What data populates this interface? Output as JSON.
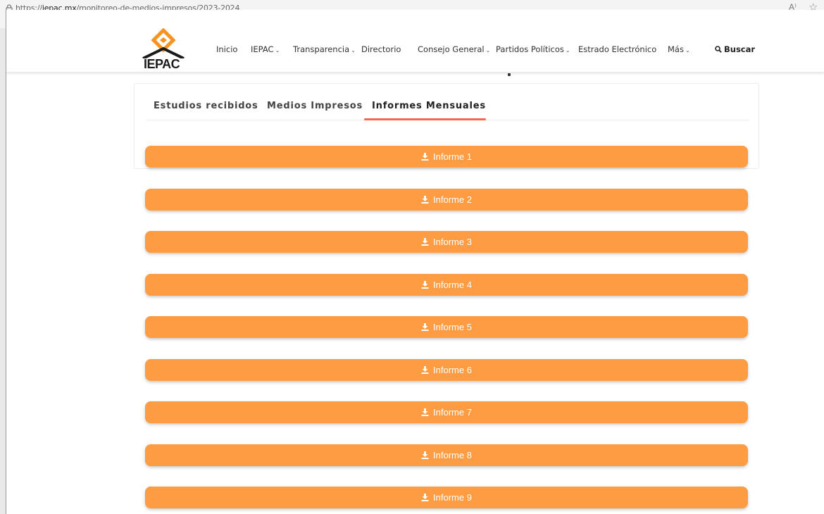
{
  "browser": {
    "url_prefix": "https://",
    "url_domain": "iepac.mx",
    "url_path": "/monitoreo-de-medios-impresos/2023-2024",
    "read_aloud_icon": "A⁾",
    "favorite_icon": "☆"
  },
  "header": {
    "logo_text": "IEPAC",
    "brand_color": "#f7931e",
    "nav": [
      {
        "label": "Inicio",
        "dropdown": false
      },
      {
        "label": "IEPAC",
        "dropdown": true
      },
      {
        "label": "Transparencia",
        "dropdown": true
      },
      {
        "label": "Directorio",
        "dropdown": false
      },
      {
        "label": "Consejo General",
        "dropdown": true
      },
      {
        "label": "Partidos Políticos",
        "dropdown": true
      },
      {
        "label": "Estrado Electrónico",
        "dropdown": false
      },
      {
        "label": "Más",
        "dropdown": true
      }
    ],
    "chevron": "⌄",
    "search_icon": "⌕",
    "search_label": "Buscar"
  },
  "tabs": {
    "items": [
      "Estudios recibidos",
      "Medios Impresos",
      "Informes Mensuales"
    ],
    "active_index": 2,
    "accent_color": "#ef6b4e"
  },
  "reports": {
    "button_color": "#fd9c42",
    "icon": "download-icon",
    "items": [
      "Informe 1",
      "Informe 2",
      "Informe 3",
      "Informe 4",
      "Informe 5",
      "Informe 6",
      "Informe 7",
      "Informe 8",
      "Informe 9"
    ]
  }
}
